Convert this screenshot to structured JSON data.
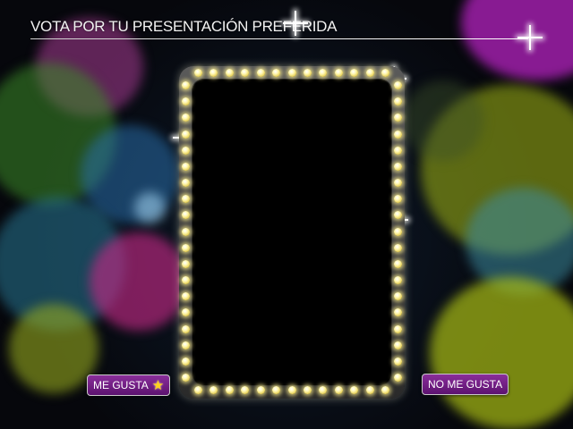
{
  "header": {
    "title": "VOTA POR TU PRESENTACIÓN PREFERIDA"
  },
  "buttons": {
    "like_label": "ME GUSTA",
    "like_icon": "star-icon",
    "dislike_label": "NO ME GUSTA"
  },
  "colors": {
    "button_bg": "#6e1d82",
    "star": "#ffd21f",
    "bulb": "#fff7b0"
  }
}
